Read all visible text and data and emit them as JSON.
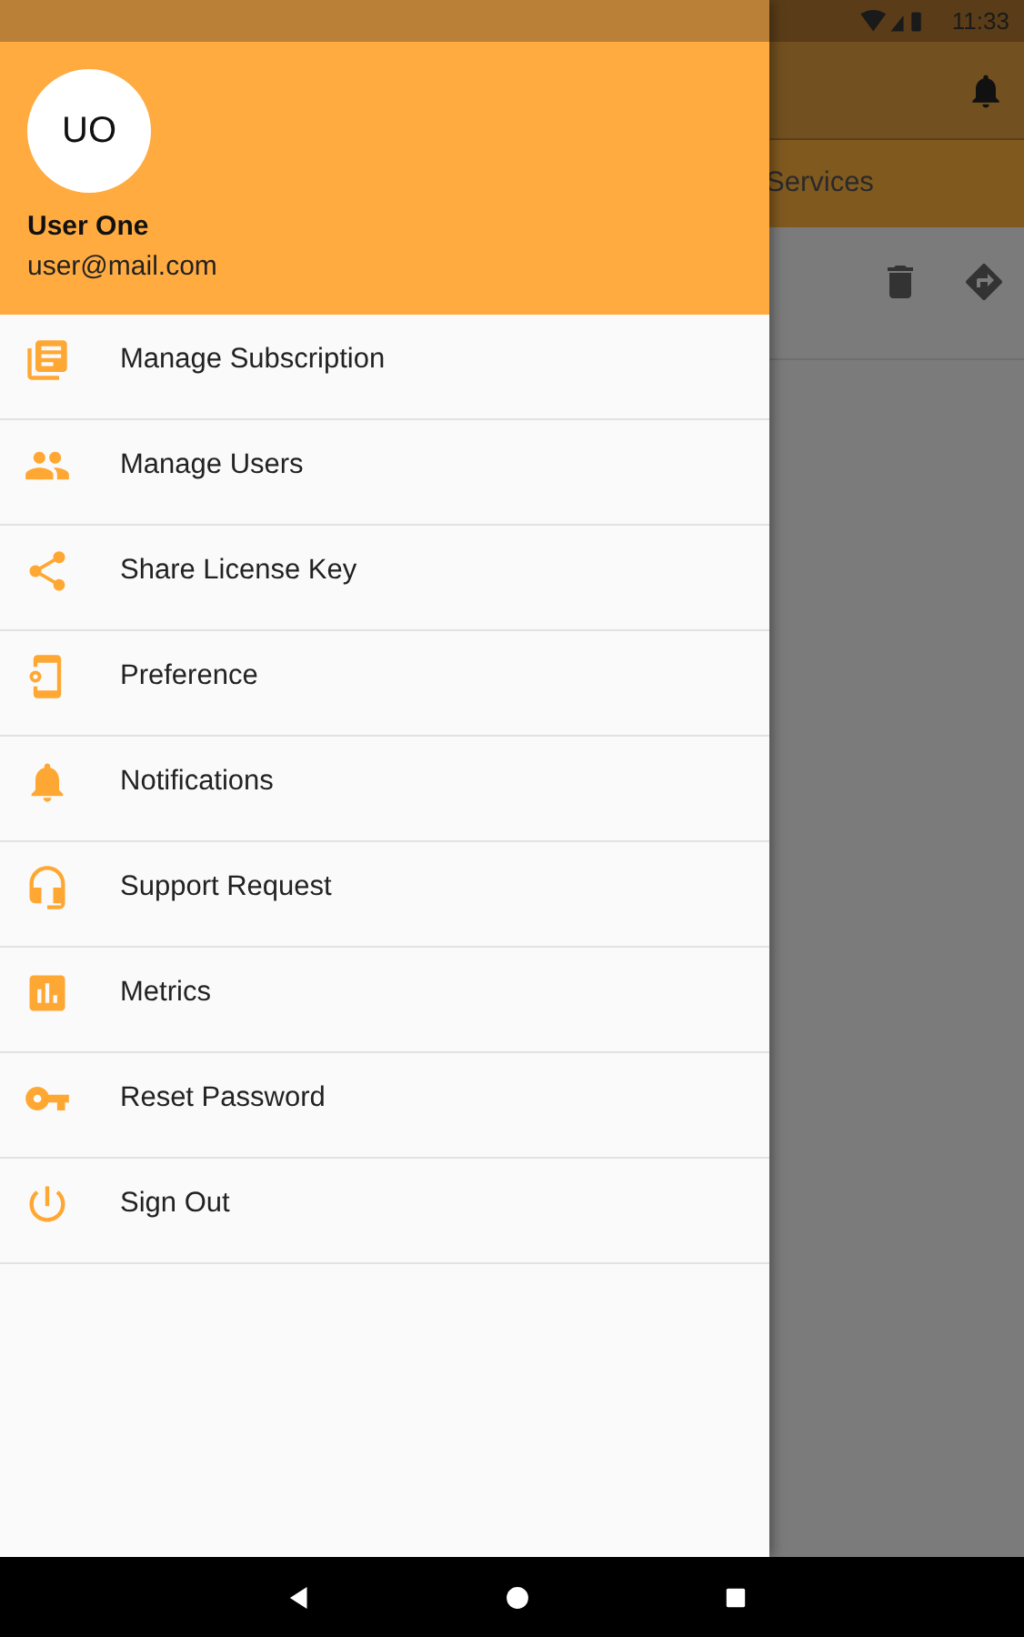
{
  "status_bar": {
    "time": "11:33"
  },
  "drawer": {
    "avatar": "UO",
    "name": "User One",
    "email": "user@mail.com",
    "items": [
      {
        "label": "Manage Subscription"
      },
      {
        "label": "Manage Users"
      },
      {
        "label": "Share License Key"
      },
      {
        "label": "Preference"
      },
      {
        "label": "Notifications"
      },
      {
        "label": "Support Request"
      },
      {
        "label": "Metrics"
      },
      {
        "label": "Reset Password"
      },
      {
        "label": "Sign Out"
      }
    ]
  },
  "background_app": {
    "tab": "Services"
  }
}
